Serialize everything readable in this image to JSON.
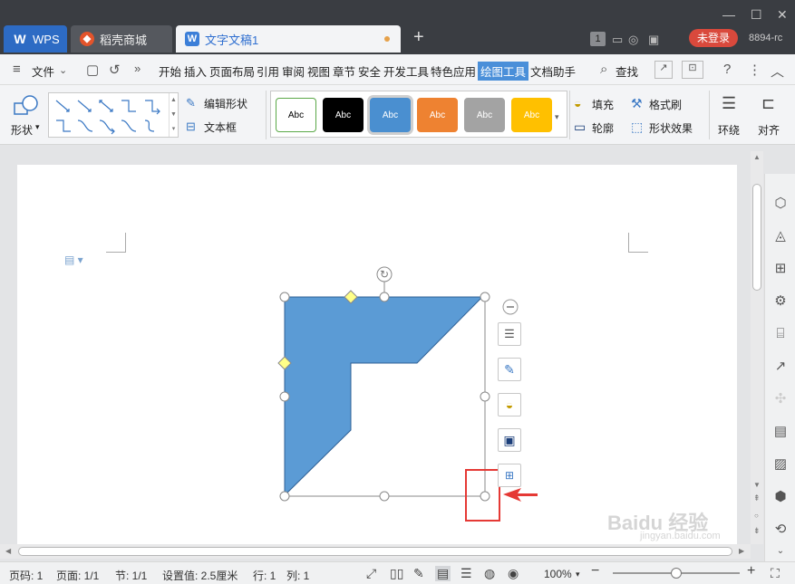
{
  "titlebar": {
    "tabs": [
      {
        "label": "WPS"
      },
      {
        "label": "稻壳商城"
      },
      {
        "label": "文字文稿1"
      }
    ],
    "new_tab": "+",
    "badge_count": "1",
    "login_label": "未登录",
    "user_id": "8894-rc"
  },
  "menubar": {
    "file_label": "文件",
    "items": [
      "开始",
      "插入",
      "页面布局",
      "引用",
      "审阅",
      "视图",
      "章节",
      "安全",
      "开发工具",
      "特色应用",
      "绘图工具",
      "文档助手"
    ],
    "active_item": "绘图工具",
    "search_label": "查找"
  },
  "ribbon": {
    "shape_label": "形状",
    "edit_shape_label": "编辑形状",
    "textbox_label": "文本框",
    "style_items": [
      {
        "text": "Abc",
        "bg": "#ffffff",
        "fg": "#000000",
        "border": "#5aa847"
      },
      {
        "text": "Abc",
        "bg": "#000000",
        "fg": "#ffffff",
        "border": "#000000"
      },
      {
        "text": "Abc",
        "bg": "#4a8fd0",
        "fg": "#ffffff",
        "border": "#4a8fd0"
      },
      {
        "text": "Abc",
        "bg": "#ee8231",
        "fg": "#ffffff",
        "border": "#ee8231"
      },
      {
        "text": "Abc",
        "bg": "#a3a3a3",
        "fg": "#ffffff",
        "border": "#a3a3a3"
      },
      {
        "text": "Abc",
        "bg": "#ffc000",
        "fg": "#ffffff",
        "border": "#ffc000"
      }
    ],
    "fill_label": "填充",
    "format_brush_label": "格式刷",
    "outline_label": "轮廓",
    "shape_effect_label": "形状效果",
    "wrap_label": "环绕",
    "align_label": "对齐"
  },
  "shape": {
    "fill": "#5b9bd5",
    "type": "L-shape"
  },
  "statusbar": {
    "page_num": "页码: 1",
    "pages": "页面: 1/1",
    "section": "节: 1/1",
    "setting": "设置值: 2.5厘米",
    "row": "行: 1",
    "col": "列: 1",
    "zoom": "100%",
    "zoom_level": 0.5
  },
  "watermark": {
    "brand": "Baidu 经验",
    "url": "jingyan.baidu.com"
  },
  "colors": {
    "titlebar_bg": "#3a3d42",
    "accent": "#4a8fd9",
    "login_red": "#d9493c",
    "highlight_red": "#e53935"
  }
}
